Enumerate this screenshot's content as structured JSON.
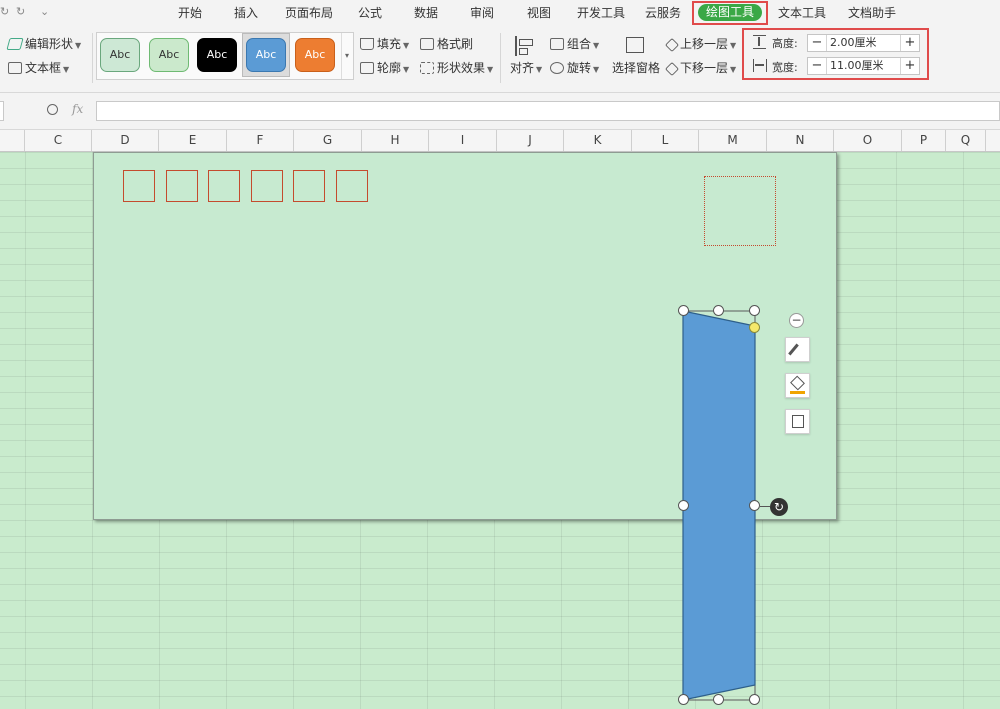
{
  "quick_access": {
    "redo_icon": "redo-icon",
    "dropdown_icon": "chevron-down-icon",
    "redo_glyph": "↻",
    "dropdown_glyph": "⌄"
  },
  "tabs": [
    {
      "label": "开始"
    },
    {
      "label": "插入"
    },
    {
      "label": "页面布局"
    },
    {
      "label": "公式"
    },
    {
      "label": "数据"
    },
    {
      "label": "审阅"
    },
    {
      "label": "视图"
    },
    {
      "label": "开发工具"
    },
    {
      "label": "云服务"
    },
    {
      "label": "绘图工具"
    },
    {
      "label": "文本工具"
    },
    {
      "label": "文档助手"
    }
  ],
  "active_tab": "绘图工具",
  "ribbon": {
    "edit_shape": "编辑形状",
    "textbox": "文本框",
    "styles": [
      {
        "label": "Abc",
        "bg": "#cde8d5",
        "border": "#6aa77d",
        "color": "#333"
      },
      {
        "label": "Abc",
        "bg": "#cbe9cc",
        "border": "#6fba73",
        "color": "#333"
      },
      {
        "label": "Abc",
        "bg": "#000000",
        "border": "#000000",
        "color": "#ffffff"
      },
      {
        "label": "Abc",
        "bg": "#5b9bd5",
        "border": "#3b78b0",
        "color": "#ffffff"
      },
      {
        "label": "Abc",
        "bg": "#ed7d31",
        "border": "#c9601b",
        "color": "#ffffff"
      }
    ],
    "fill": "填充",
    "outline": "轮廓",
    "format_painter": "格式刷",
    "shape_effects": "形状效果",
    "align": "对齐",
    "group": "组合",
    "rotate": "旋转",
    "selection_pane": "选择窗格",
    "bring_forward": "上移一层",
    "send_backward": "下移一层",
    "height_label": "高度:",
    "height_value": "2.00厘米",
    "width_label": "宽度:",
    "width_value": "11.00厘米"
  },
  "formula_bar": {
    "fx": "fx"
  },
  "columns": [
    "C",
    "D",
    "E",
    "F",
    "G",
    "H",
    "I",
    "J",
    "K",
    "L",
    "M",
    "N",
    "O",
    "P",
    "Q"
  ],
  "colors": {
    "accent_tab": "#3aa846",
    "highlight": "#e04b4b",
    "shape_fill": "#5b9bd5",
    "sheet_bg": "#c9ebcd"
  }
}
